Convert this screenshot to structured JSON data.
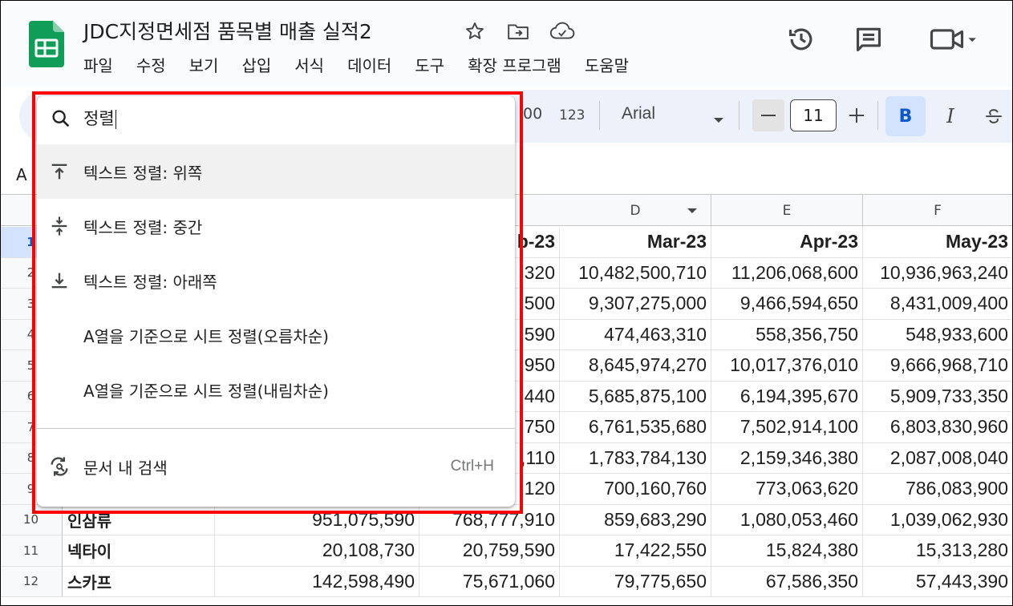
{
  "document": {
    "title": "JDC지정면세점 품목별 매출 실적2"
  },
  "menu": [
    "파일",
    "수정",
    "보기",
    "삽입",
    "서식",
    "데이터",
    "도구",
    "확장 프로그램",
    "도움말"
  ],
  "toolbar": {
    "decimal_fragment": ".00",
    "number_format": "123",
    "font_name": "Arial",
    "font_size": "11",
    "bold_label": "B",
    "italic_label": "I"
  },
  "name_box_letter": "A",
  "columns": [
    "D",
    "E",
    "F"
  ],
  "rows": [
    {
      "n": "1",
      "name": "",
      "b": "",
      "c": "b-23",
      "d": "Mar-23",
      "e": "Apr-23",
      "f": "May-23",
      "header": true
    },
    {
      "n": "2",
      "name": "",
      "b": "",
      "c": ",320",
      "d": "10,482,500,710",
      "e": "11,206,068,600",
      "f": "10,936,963,240"
    },
    {
      "n": "3",
      "name": "",
      "b": "",
      "c": ",500",
      "d": "9,307,275,000",
      "e": "9,466,594,650",
      "f": "8,431,009,400"
    },
    {
      "n": "4",
      "name": "",
      "b": "",
      "c": ",590",
      "d": "474,463,310",
      "e": "558,356,750",
      "f": "548,933,600"
    },
    {
      "n": "5",
      "name": "",
      "b": "",
      "c": ",950",
      "d": "8,645,974,270",
      "e": "10,017,376,010",
      "f": "9,666,968,710"
    },
    {
      "n": "6",
      "name": "",
      "b": "",
      "c": ",440",
      "d": "5,685,875,100",
      "e": "6,194,395,670",
      "f": "5,909,733,350"
    },
    {
      "n": "7",
      "name": "",
      "b": "",
      "c": ",750",
      "d": "6,761,535,680",
      "e": "7,502,914,100",
      "f": "6,803,830,960"
    },
    {
      "n": "8",
      "name": "",
      "b": "",
      "c": ",110",
      "d": "1,783,784,130",
      "e": "2,159,346,380",
      "f": "2,087,008,040"
    },
    {
      "n": "9",
      "name": "",
      "b": "",
      "c": ",120",
      "d": "700,160,760",
      "e": "773,063,620",
      "f": "786,083,900"
    },
    {
      "n": "10",
      "name": "인삼류",
      "b": "951,075,590",
      "c": "768,777,910",
      "d": "859,683,290",
      "e": "1,080,053,460",
      "f": "1,039,062,930"
    },
    {
      "n": "11",
      "name": "넥타이",
      "b": "20,108,730",
      "c": "20,759,590",
      "d": "17,422,550",
      "e": "15,824,380",
      "f": "15,313,280"
    },
    {
      "n": "12",
      "name": "스카프",
      "b": "142,598,490",
      "c": "75,671,060",
      "d": "79,775,650",
      "e": "67,586,350",
      "f": "57,443,390"
    }
  ],
  "palette": {
    "query": "정렬",
    "items": [
      {
        "label": "텍스트 정렬: 위쪽",
        "icon": "align-top-icon"
      },
      {
        "label": "텍스트 정렬: 중간",
        "icon": "align-middle-icon"
      },
      {
        "label": "텍스트 정렬: 아래쪽",
        "icon": "align-bottom-icon"
      },
      {
        "label": "A열을 기준으로 시트 정렬(오름차순)",
        "icon": ""
      },
      {
        "label": "A열을 기준으로 시트 정렬(내림차순)",
        "icon": ""
      }
    ],
    "find": {
      "label": "문서 내 검색",
      "shortcut": "Ctrl+H",
      "icon": "find-in-document-icon"
    }
  },
  "colors": {
    "accent": "#0b57d0",
    "selection": "#d3e3fd",
    "highlight_frame": "#ff0000",
    "sheets_green": "#0f9d58"
  }
}
